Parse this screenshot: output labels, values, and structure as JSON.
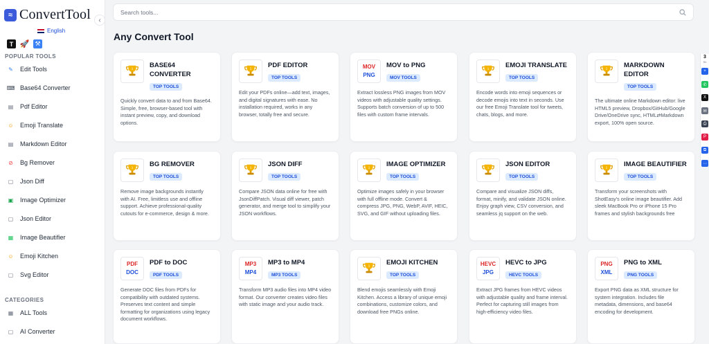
{
  "app": {
    "logo_text": "ConvertTool",
    "language": "English"
  },
  "search": {
    "placeholder": "Search tools..."
  },
  "page_title": "Any Convert Tool",
  "sidebar": {
    "popular_label": "POPULAR TOOLS",
    "categories_label": "CATEGORIES",
    "popular": [
      {
        "label": "Edit Tools",
        "icon": "edit-icon",
        "color": "#3b82f6"
      },
      {
        "label": "Base64 Converter",
        "icon": "code-icon",
        "color": "#374151"
      },
      {
        "label": "Pdf Editor",
        "icon": "document-icon",
        "color": "#6b7280"
      },
      {
        "label": "Emoji Translate",
        "icon": "emoji-icon",
        "color": "#f59e0b"
      },
      {
        "label": "Markdown Editor",
        "icon": "markdown-icon",
        "color": "#6b7280"
      },
      {
        "label": "Bg Remover",
        "icon": "slash-icon",
        "color": "#ef4444"
      },
      {
        "label": "Json Diff",
        "icon": "file-icon",
        "color": "#6b7280"
      },
      {
        "label": "Image Optimizer",
        "icon": "image-icon",
        "color": "#16a34a"
      },
      {
        "label": "Json Editor",
        "icon": "file-icon",
        "color": "#6b7280"
      },
      {
        "label": "Image Beautifier",
        "icon": "picture-icon",
        "color": "#22c55e"
      },
      {
        "label": "Emoji Kitchen",
        "icon": "emoji-icon",
        "color": "#f59e0b"
      },
      {
        "label": "Svg Editor",
        "icon": "file-icon",
        "color": "#6b7280"
      }
    ],
    "categories": [
      {
        "label": "ALL Tools",
        "icon": "grid-icon",
        "color": "#6b7280"
      },
      {
        "label": "AI Converter",
        "icon": "file-icon",
        "color": "#6b7280"
      }
    ]
  },
  "cards": [
    {
      "title": "BASE64 CONVERTER",
      "badge": "TOP TOOLS",
      "desc": "Quickly convert data to and from Base64. Simple, free, browser-based tool with instant preview, copy, and download options.",
      "thumb": "trophy"
    },
    {
      "title": "PDF EDITOR",
      "badge": "TOP TOOLS",
      "desc": "Edit your PDFs online—add text, images, and digital signatures with ease. No installation required, works in any browser, totally free and secure.",
      "thumb": "trophy"
    },
    {
      "title": "MOV to PNG",
      "badge": "MOV TOOLS",
      "desc": "Extract lossless PNG images from MOV videos with adjustable quality settings. Supports batch conversion of up to 500 files with custom frame intervals.",
      "thumb": "format",
      "fmt_top": "MOV",
      "fmt_bot": "PNG"
    },
    {
      "title": "EMOJI TRANSLATE",
      "badge": "TOP TOOLS",
      "desc": "Encode words into emoji sequences or decode emojis into text in seconds. Use our free Emoji Translate tool for tweets, chats, blogs, and more.",
      "thumb": "trophy"
    },
    {
      "title": "MARKDOWN EDITOR",
      "badge": "TOP TOOLS",
      "desc": "The ultimate online Markdown editor: live HTML5 preview, Dropbox/GitHub/Google Drive/OneDrive sync, HTML⇄Markdown export, 100% open source.",
      "thumb": "trophy"
    },
    {
      "title": "BG REMOVER",
      "badge": "TOP TOOLS",
      "desc": "Remove image backgrounds instantly with AI. Free, limitless use and offline support. Achieve professional-quality cutouts for e-commerce, design & more.",
      "thumb": "trophy"
    },
    {
      "title": "JSON DIFF",
      "badge": "TOP TOOLS",
      "desc": "Compare JSON data online for free with JsonDiffPatch. Visual diff viewer, patch generator, and merge tool to simplify your JSON workflows.",
      "thumb": "trophy"
    },
    {
      "title": "IMAGE OPTIMIZER",
      "badge": "TOP TOOLS",
      "desc": "Optimize images safely in your browser with full offline mode. Convert & compress JPG, PNG, WebP, AVIF, HEIC, SVG, and GIF without uploading files.",
      "thumb": "trophy"
    },
    {
      "title": "JSON EDITOR",
      "badge": "TOP TOOLS",
      "desc": "Compare and visualize JSON diffs, format, minify, and validate JSON online. Enjoy graph view, CSV conversion, and seamless jq support on the web.",
      "thumb": "trophy"
    },
    {
      "title": "IMAGE BEAUTIFIER",
      "badge": "TOP TOOLS",
      "desc": "Transform your screenshots with ShotEasy's online image beautifier. Add sleek MacBook Pro or iPhone 15 Pro frames and stylish backgrounds free",
      "thumb": "trophy"
    },
    {
      "title": "PDF to DOC",
      "badge": "PDF TOOLS",
      "desc": "Generate DOC files from PDFs for compatibility with outdated systems. Preserves text content and simple formatting for organizations using legacy document workflows.",
      "thumb": "format",
      "fmt_top": "PDF",
      "fmt_bot": "DOC"
    },
    {
      "title": "MP3 to MP4",
      "badge": "MP3 TOOLS",
      "desc": "Transform MP3 audio files into MP4 video format. Our converter creates video files with static image and your audio track.",
      "thumb": "format",
      "fmt_top": "MP3",
      "fmt_bot": "MP4"
    },
    {
      "title": "EMOJI KITCHEN",
      "badge": "TOP TOOLS",
      "desc": "Blend emojis seamlessly with Emoji Kitchen. Access a library of unique emoji combinations, customize colors, and download free PNGs online.",
      "thumb": "trophy"
    },
    {
      "title": "HEVC to JPG",
      "badge": "HEVC TOOLS",
      "desc": "Extract JPG frames from HEVC videos with adjustable quality and frame interval. Perfect for capturing still images from high-efficiency video files.",
      "thumb": "format",
      "fmt_top": "HEVC",
      "fmt_bot": "JPG"
    },
    {
      "title": "PNG to XML",
      "badge": "PNG TOOLS",
      "desc": "Export PNG data as XML structure for system integration. Includes file metadata, dimensions, and base64 encoding for development.",
      "thumb": "format",
      "fmt_top": "PNG",
      "fmt_bot": "XML"
    }
  ],
  "share": {
    "count": "3",
    "label": "Sh",
    "buttons": [
      {
        "icon": "add-icon",
        "color": "#2563eb"
      },
      {
        "icon": "whatsapp-icon",
        "color": "#22c55e"
      },
      {
        "icon": "x-icon",
        "color": "#111111"
      },
      {
        "icon": "email-icon",
        "color": "#6b7280"
      },
      {
        "icon": "print-icon",
        "color": "#374151"
      },
      {
        "icon": "pinterest-icon",
        "color": "#e11d48"
      },
      {
        "icon": "copy-icon",
        "color": "#2563eb"
      },
      {
        "icon": "more-icon",
        "color": "#2563eb"
      }
    ]
  }
}
